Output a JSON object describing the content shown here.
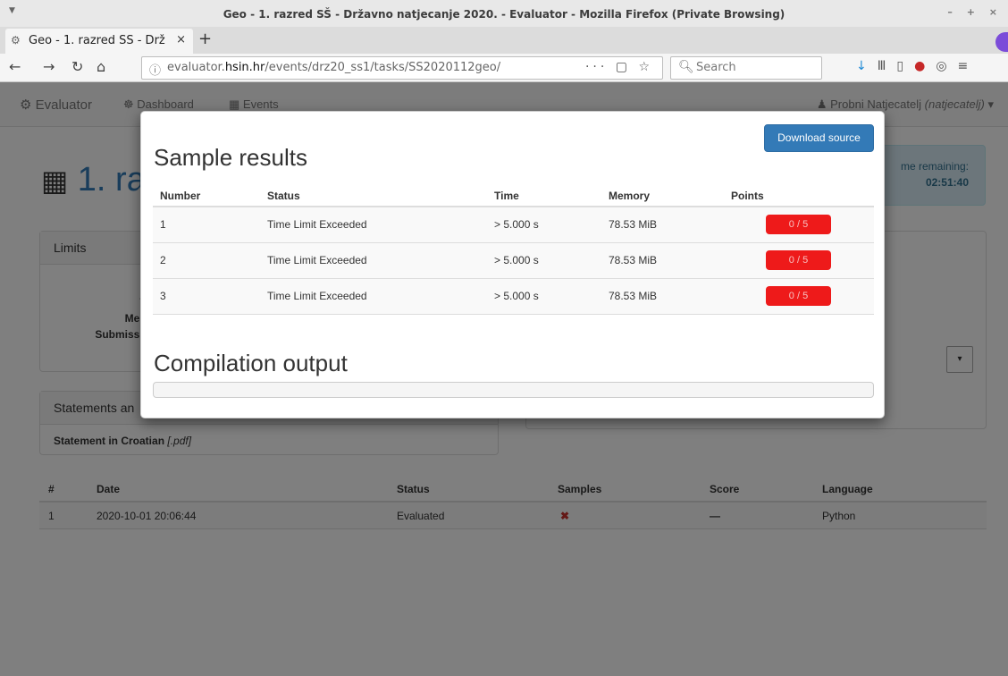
{
  "window": {
    "title": "Geo - 1. razred SŠ - Državno natjecanje 2020. - Evaluator - Mozilla Firefox (Private Browsing)",
    "controls": "– + ×"
  },
  "tab": {
    "title": "Geo - 1. razred SŠ - Drž",
    "close": "×",
    "new_tab": "+"
  },
  "nav": {
    "url_host_prefix": "evaluator.",
    "url_host_domain": "hsin.hr",
    "url_path": "/events/drz20_ss1/tasks/SS2020112geo/",
    "url_actions": "··· ▢ ☆",
    "search_placeholder": "Search"
  },
  "app": {
    "brand": "Evaluator",
    "links": [
      "Dashboard",
      "Events"
    ],
    "user_name": "Probni Natjecatelj",
    "user_role": "(natjecatelj)"
  },
  "page": {
    "title_partial": "1. ra",
    "time_label": "me remaining:",
    "time_value": "02:51:40",
    "limits_heading": "Limits",
    "limit_labels": [
      "Ti",
      "Mem",
      "Submissio"
    ],
    "statements_heading": "Statements an",
    "statement_link": "Statement in Croatian",
    "statement_format": "[.pdf]"
  },
  "submissions": {
    "headers": [
      "#",
      "Date",
      "Status",
      "Samples",
      "Score",
      "Language"
    ],
    "rows": [
      {
        "num": "1",
        "date": "2020-10-01 20:06:44",
        "status": "Evaluated",
        "samples": "✖",
        "score": "—",
        "language": "Python"
      }
    ]
  },
  "modal": {
    "title": "Sample results",
    "download_label": "Download source",
    "headers": [
      "Number",
      "Status",
      "Time",
      "Memory",
      "Points"
    ],
    "rows": [
      {
        "number": "1",
        "status": "Time Limit Exceeded",
        "time": "> 5.000 s",
        "memory": "78.53 MiB",
        "points": "0 / 5"
      },
      {
        "number": "2",
        "status": "Time Limit Exceeded",
        "time": "> 5.000 s",
        "memory": "78.53 MiB",
        "points": "0 / 5"
      },
      {
        "number": "3",
        "status": "Time Limit Exceeded",
        "time": "> 5.000 s",
        "memory": "78.53 MiB",
        "points": "0 / 5"
      }
    ],
    "compile_title": "Compilation output"
  },
  "colors": {
    "accent": "#337ab7",
    "points_fail": "#ee1a1a",
    "info_bg": "#d9edf7"
  }
}
